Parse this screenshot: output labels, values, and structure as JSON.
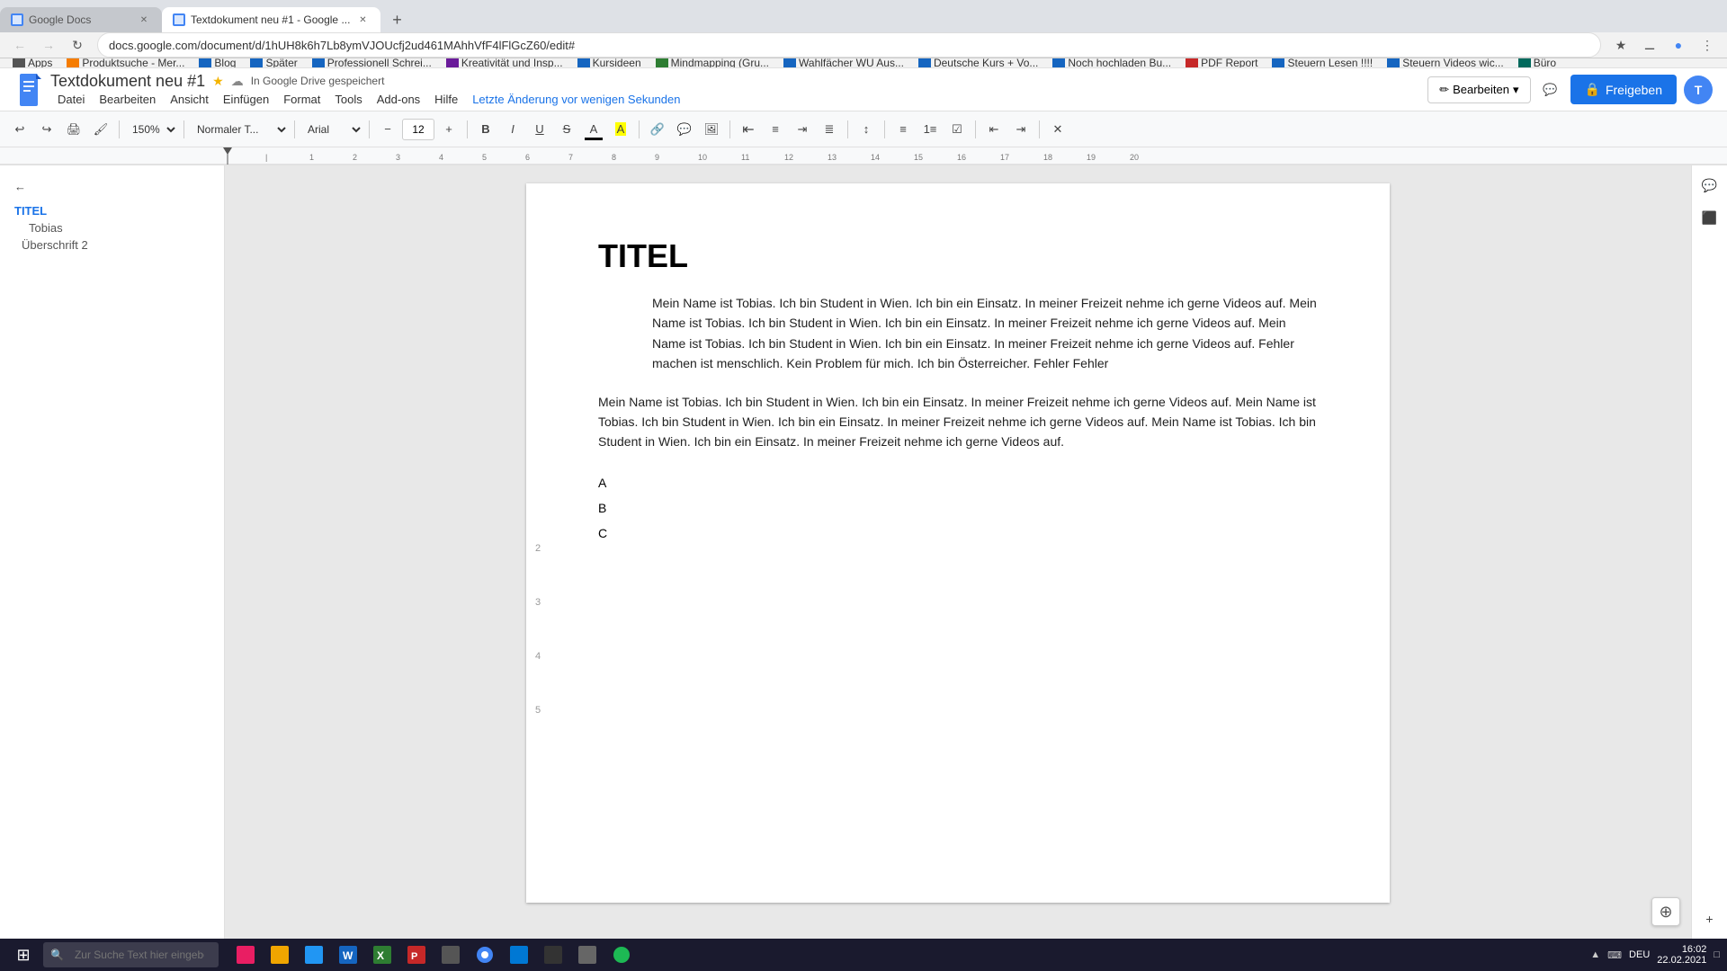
{
  "browser": {
    "tabs": [
      {
        "id": "tab-google-docs",
        "title": "Google Docs",
        "active": false,
        "favicon_color": "#4285f4"
      },
      {
        "id": "tab-textdoc",
        "title": "Textdokument neu #1 - Google ...",
        "active": true,
        "favicon_color": "#4285f4"
      }
    ],
    "address": "docs.google.com/document/d/1hUH8k6h7Lb8ymVJOUcfj2ud461MAhhVfF4lFlGcZ60/edit#",
    "nav": {
      "back": "←",
      "forward": "→",
      "refresh": "↻"
    }
  },
  "bookmarks": [
    {
      "label": "Apps",
      "icon": "apps"
    },
    {
      "label": "Produktsuche - Mer...",
      "icon": "orange"
    },
    {
      "label": "Blog",
      "icon": "blue2"
    },
    {
      "label": "Später",
      "icon": "blue2"
    },
    {
      "label": "Professionell Schrei...",
      "icon": "blue2"
    },
    {
      "label": "Kreativität und Insp...",
      "icon": "blue2"
    },
    {
      "label": "Kursideen",
      "icon": "blue2"
    },
    {
      "label": "Mindmapping  (Gru...",
      "icon": "green"
    },
    {
      "label": "Wahlfächer WU Aus...",
      "icon": "blue2"
    },
    {
      "label": "Deutsche Kurs + Vo...",
      "icon": "blue2"
    },
    {
      "label": "Noch hochladen Bu...",
      "icon": "blue2"
    },
    {
      "label": "PDF Report",
      "icon": "red"
    },
    {
      "label": "Steuern Lesen !!!!",
      "icon": "blue2"
    },
    {
      "label": "Steuern Videos wic...",
      "icon": "blue2"
    },
    {
      "label": "Büro",
      "icon": "blue2"
    }
  ],
  "doc": {
    "logo_letter": "D",
    "title": "Textdokument neu #1",
    "saved_status": "In Google Drive gespeichert",
    "menu": [
      {
        "label": "Datei"
      },
      {
        "label": "Bearbeiten"
      },
      {
        "label": "Ansicht"
      },
      {
        "label": "Einfügen"
      },
      {
        "label": "Format"
      },
      {
        "label": "Tools"
      },
      {
        "label": "Add-ons"
      },
      {
        "label": "Hilfe"
      },
      {
        "label": "Letzte Änderung vor wenigen Sekunden",
        "highlight": true
      }
    ],
    "share_label": "Freigeben",
    "share_icon": "👥",
    "edit_label": "Bearbeiten",
    "avatar_letter": "T"
  },
  "toolbar": {
    "undo": "↩",
    "redo": "↪",
    "print": "🖨",
    "paint_format": "🖌",
    "zoom": "150%",
    "style": "Normaler T...",
    "font": "Arial",
    "font_size": "12",
    "decrease_font": "−",
    "increase_font": "+",
    "bold": "B",
    "italic": "I",
    "underline": "U",
    "strikethrough": "S",
    "text_color": "A",
    "highlight_color": "A",
    "link": "🔗",
    "comment": "💬",
    "image": "🖼",
    "align_left": "≡",
    "align_center": "≡",
    "align_right": "≡",
    "align_justify": "≡",
    "line_spacing": "↕",
    "bullets": "≡",
    "numbered": "≡",
    "indent_less": "←",
    "indent_more": "→",
    "clear_format": "✕"
  },
  "outline": {
    "back_label": "←",
    "items": [
      {
        "level": "h1",
        "label": "TITEL"
      },
      {
        "level": "h2",
        "label": "Tobias"
      },
      {
        "level": "h1",
        "label": "Überschrift 2"
      }
    ]
  },
  "page": {
    "title": "TITEL",
    "para1": "Mein Name ist Tobias. Ich bin Student in Wien. Ich bin ein Einsatz. In meiner Freizeit nehme ich gerne Videos auf. Mein Name ist Tobias. Ich bin Student in Wien. Ich bin ein Einsatz. In meiner Freizeit nehme ich gerne Videos auf. Mein Name ist Tobias. Ich bin Student in Wien. Ich bin ein Einsatz. In meiner Freizeit nehme ich gerne Videos auf. Fehler machen ist menschlich. Kein Problem für mich. Ich bin Österreicher. Fehler Fehler",
    "para2": "Mein Name ist Tobias. Ich bin Student in Wien. Ich bin ein Einsatz. In meiner Freizeit nehme ich gerne Videos auf. Mein Name ist Tobias. Ich bin Student in Wien. Ich bin ein Einsatz. In meiner Freizeit nehme ich gerne Videos auf. Mein Name ist Tobias. Ich bin Student in Wien. Ich bin ein Einsatz. In meiner Freizeit nehme ich gerne Videos auf.",
    "list": [
      "A",
      "B",
      "C"
    ]
  },
  "taskbar": {
    "search_placeholder": "Zur Suche Text hier eingeben",
    "time": "16:02",
    "date": "22.02.2021",
    "layout_label": "DEU"
  },
  "zoom_icon": "⊕"
}
